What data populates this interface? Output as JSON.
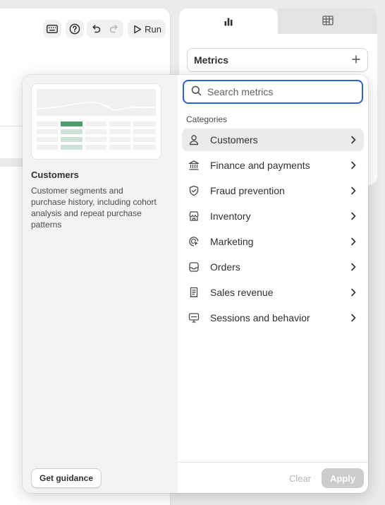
{
  "toolbar": {
    "run_label": "Run",
    "icons": [
      "keyboard-icon",
      "help-icon",
      "undo-icon",
      "redo-icon",
      "play-icon"
    ]
  },
  "side_panel": {
    "tabs": [
      {
        "icon": "bar-chart-icon",
        "active": true
      },
      {
        "icon": "table-icon",
        "active": false
      }
    ],
    "metrics_title": "Metrics"
  },
  "popover": {
    "preview": {
      "title": "Customers",
      "description": "Customer segments and purchase history, including cohort analysis and repeat purchase patterns",
      "guidance_label": "Get guidance"
    },
    "search": {
      "placeholder": "Search metrics",
      "value": ""
    },
    "categories_heading": "Categories",
    "categories": [
      {
        "label": "Customers",
        "icon": "person-icon",
        "selected": true
      },
      {
        "label": "Finance and payments",
        "icon": "bank-icon",
        "selected": false
      },
      {
        "label": "Fraud prevention",
        "icon": "shield-check-icon",
        "selected": false
      },
      {
        "label": "Inventory",
        "icon": "store-icon",
        "selected": false
      },
      {
        "label": "Marketing",
        "icon": "target-icon",
        "selected": false
      },
      {
        "label": "Orders",
        "icon": "inbox-icon",
        "selected": false
      },
      {
        "label": "Sales revenue",
        "icon": "receipt-icon",
        "selected": false
      },
      {
        "label": "Sessions and behavior",
        "icon": "monitor-icon",
        "selected": false
      }
    ],
    "footer": {
      "clear_label": "Clear",
      "apply_label": "Apply"
    }
  },
  "colors": {
    "focus_ring": "#2f5fd0",
    "preview_accent": "#4f9a6f",
    "selected_row": "#ebebeb"
  }
}
